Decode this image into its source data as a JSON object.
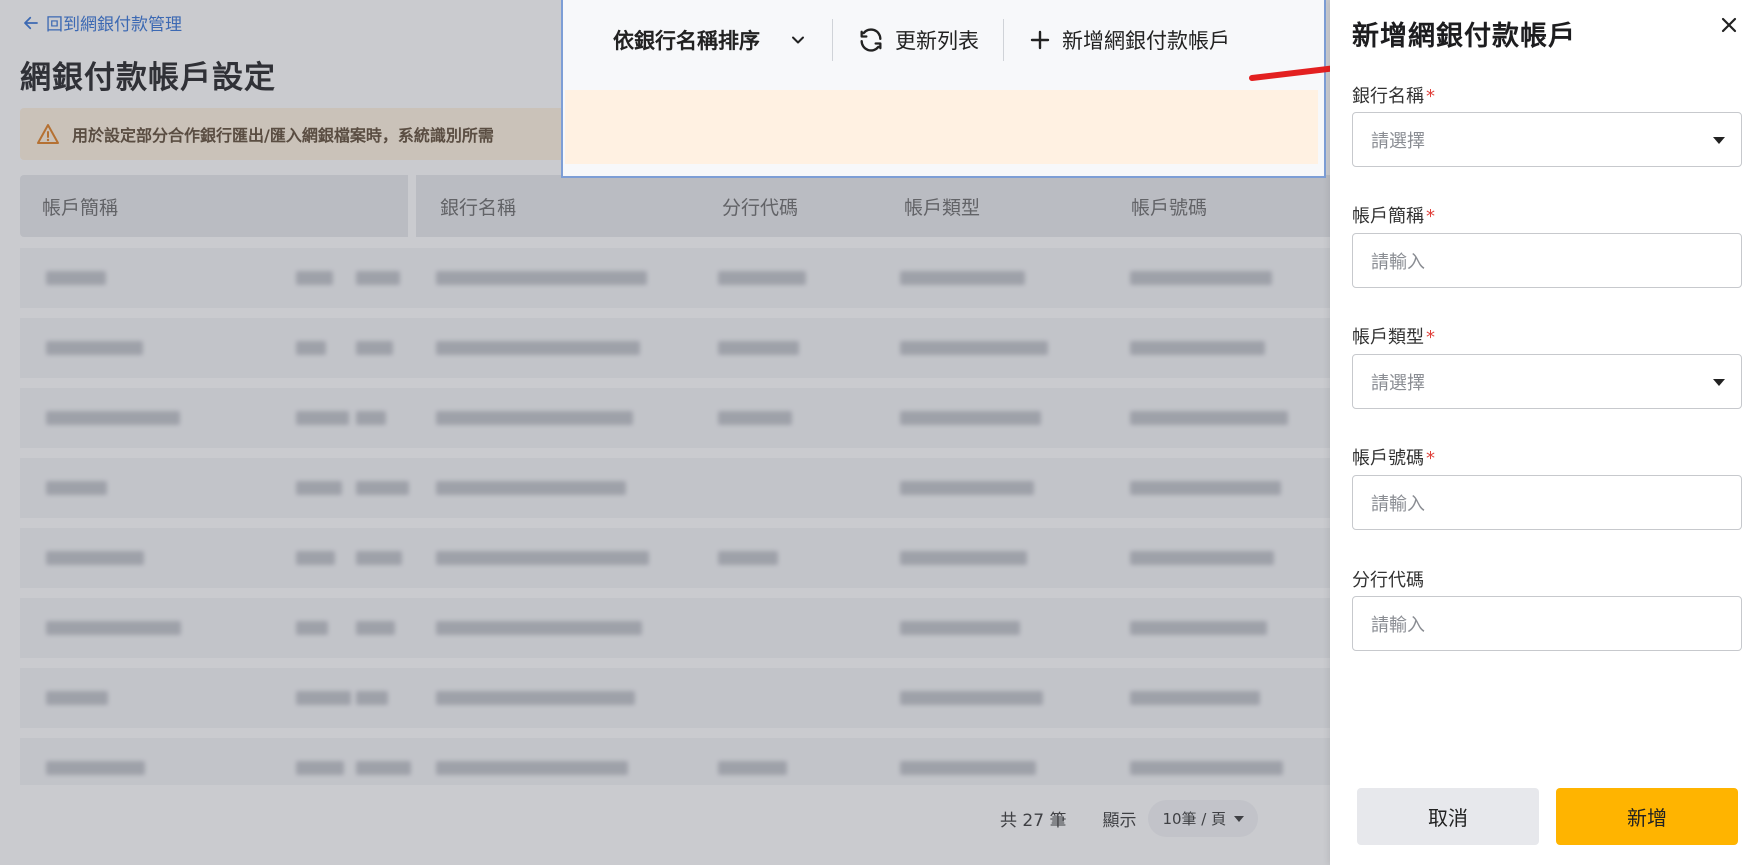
{
  "page": {
    "back_link": "回到網銀付款管理",
    "title": "網銀付款帳戶設定",
    "warning": "用於設定部分合作銀行匯出/匯入網銀檔案時，系統識別所需",
    "columns": [
      "帳戶簡稱",
      "銀行名稱",
      "分行代碼",
      "帳戶類型",
      "帳戶號碼"
    ],
    "footer": {
      "total": "共 27 筆",
      "display_label": "顯示",
      "page_size": "10筆 / 頁"
    }
  },
  "toolbar": {
    "sort_label": "依銀行名稱排序",
    "refresh_label": "更新列表",
    "add_label": "新增網銀付款帳戶"
  },
  "drawer": {
    "title": "新增網銀付款帳戶",
    "fields": [
      {
        "label": "銀行名稱",
        "required": true,
        "placeholder": "請選擇",
        "type": "select"
      },
      {
        "label": "帳戶簡稱",
        "required": true,
        "placeholder": "請輸入",
        "type": "input"
      },
      {
        "label": "帳戶類型",
        "required": true,
        "placeholder": "請選擇",
        "type": "select"
      },
      {
        "label": "帳戶號碼",
        "required": true,
        "placeholder": "請輸入",
        "type": "input"
      },
      {
        "label": "分行代碼",
        "required": false,
        "placeholder": "請輸入",
        "type": "input"
      }
    ],
    "required_mark": "*",
    "cancel_label": "取消",
    "submit_label": "新增"
  },
  "colors": {
    "accent": "#ffb400",
    "link": "#2f6fd6",
    "required": "#e0403a",
    "warning_bg": "#fff2df"
  }
}
